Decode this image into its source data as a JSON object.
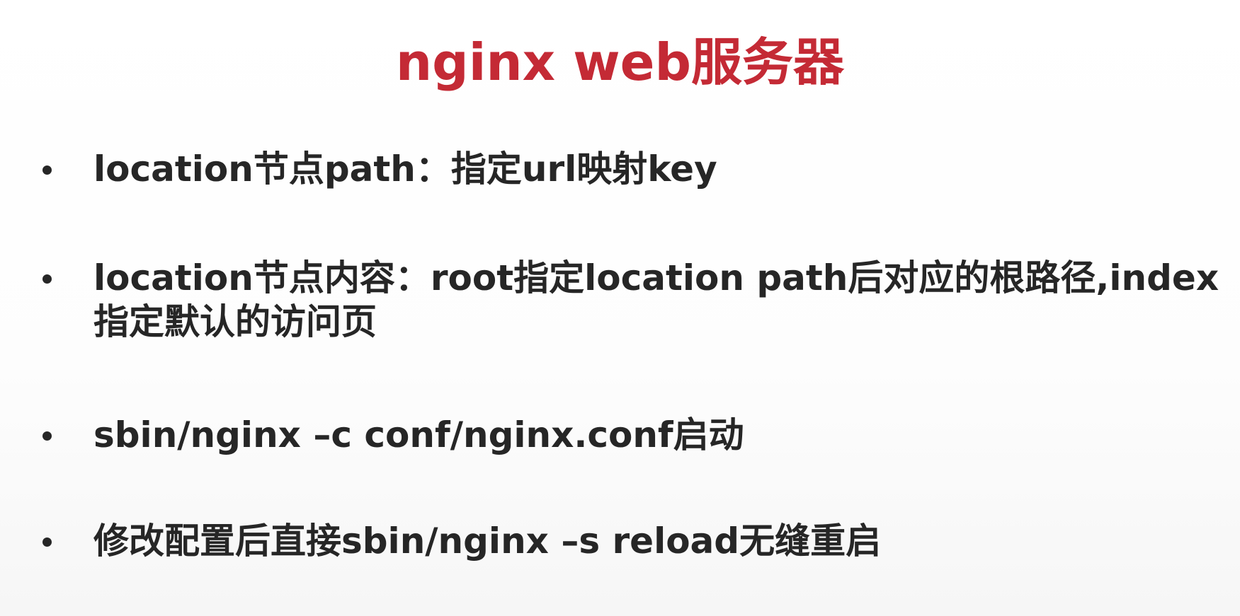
{
  "slide": {
    "title": "nginx web服务器",
    "bullets": [
      {
        "lines": [
          "location节点path：指定url映射key"
        ]
      },
      {
        "lines": [
          "location节点内容：root指定location path后对应的根路径,index",
          "指定默认的访问页"
        ]
      },
      {
        "lines": [
          "sbin/nginx –c conf/nginx.conf启动"
        ]
      },
      {
        "lines": [
          "修改配置后直接sbin/nginx –s reload无缝重启"
        ]
      }
    ]
  },
  "colors": {
    "title": "#c42a35",
    "text": "#262626",
    "background": "#ffffff"
  }
}
